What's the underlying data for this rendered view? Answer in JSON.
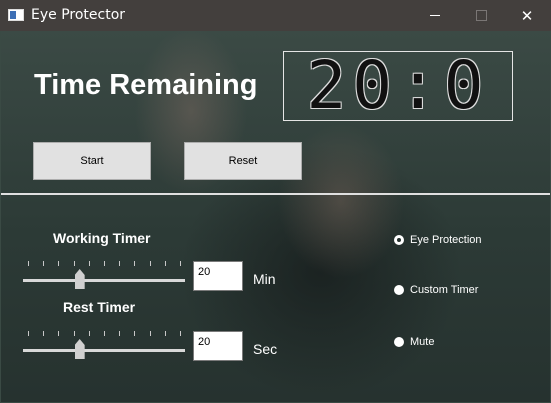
{
  "window": {
    "title": "Eye Protector",
    "close_glyph": "✕"
  },
  "header": {
    "time_remaining_label": "Time Remaining",
    "timer_display": "20:0"
  },
  "controls": {
    "start_label": "Start",
    "reset_label": "Reset"
  },
  "working_timer": {
    "label": "Working Timer",
    "value": "20",
    "unit": "Min",
    "slider_fraction": 0.34
  },
  "rest_timer": {
    "label": "Rest Timer",
    "value": "20",
    "unit": "Sec",
    "slider_fraction": 0.34
  },
  "modes": [
    {
      "label": "Eye Protection",
      "selected": true
    },
    {
      "label": "Custom Timer",
      "selected": false
    },
    {
      "label": "Mute",
      "selected": false
    }
  ]
}
